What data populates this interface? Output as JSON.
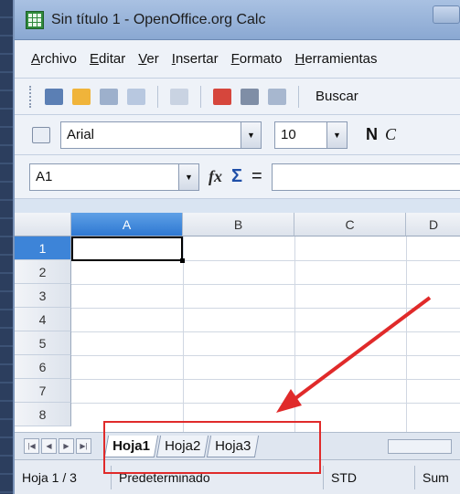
{
  "window": {
    "title": "Sin título 1 - OpenOffice.org Calc"
  },
  "menu": {
    "items": [
      "Archivo",
      "Editar",
      "Ver",
      "Insertar",
      "Formato",
      "Herramientas"
    ],
    "underlined": [
      "A",
      "E",
      "V",
      "I",
      "F",
      "H"
    ],
    "rest": [
      "rchivo",
      "ditar",
      "er",
      "nsertar",
      "ormato",
      "erramientas"
    ]
  },
  "toolbar": {
    "search_label": "Buscar"
  },
  "format": {
    "font_name": "Arial",
    "font_size": "10",
    "bold_label": "N",
    "italic_label": "C"
  },
  "formula": {
    "name_box": "A1",
    "fx_label": "fx",
    "sigma_label": "Σ",
    "equals_label": "=",
    "value": ""
  },
  "grid": {
    "columns": [
      "A",
      "B",
      "C",
      "D"
    ],
    "rows": [
      "1",
      "2",
      "3",
      "4",
      "5",
      "6",
      "7",
      "8"
    ],
    "active_cell": "A1"
  },
  "sheets": {
    "tabs": [
      "Hoja1",
      "Hoja2",
      "Hoja3"
    ],
    "active": "Hoja1"
  },
  "status": {
    "sheet_position": "Hoja 1 / 3",
    "page_style": "Predeterminado",
    "mode": "STD",
    "sum": "Sum"
  },
  "colors": {
    "annotation": "#e02a2a",
    "active_header": "#3d84d8"
  }
}
